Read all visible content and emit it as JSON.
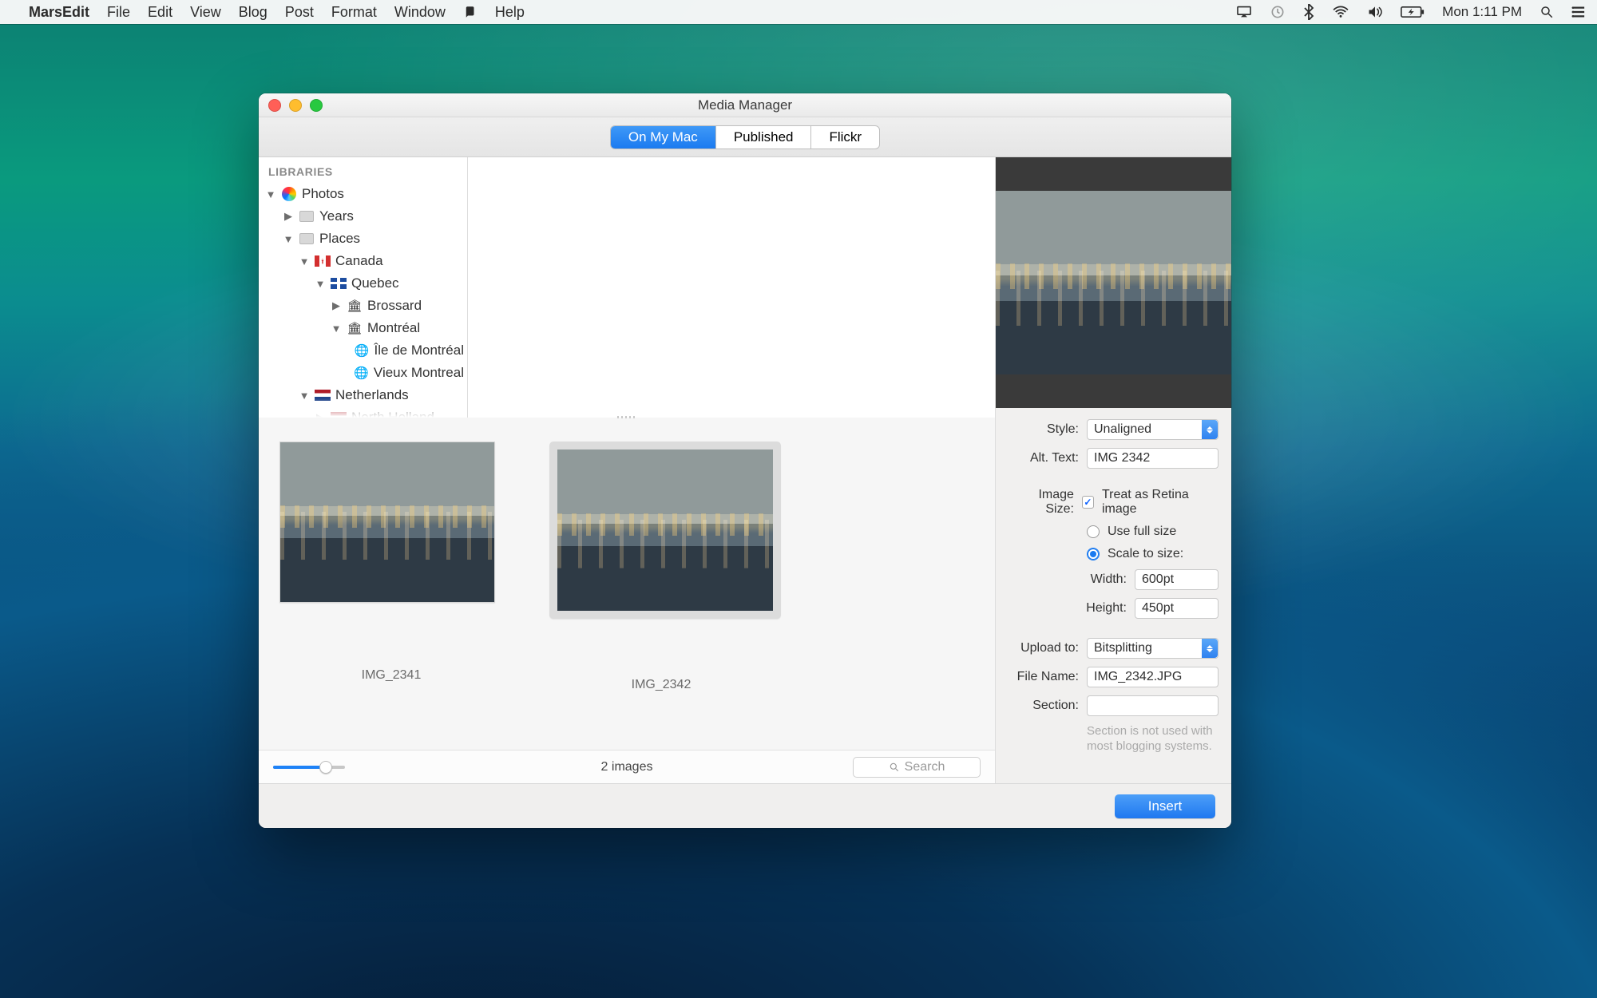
{
  "menubar": {
    "app_name": "MarsEdit",
    "items": [
      "File",
      "Edit",
      "View",
      "Blog",
      "Post",
      "Format",
      "Window",
      "",
      "Help"
    ],
    "clock": "Mon 1:11 PM"
  },
  "window": {
    "title": "Media Manager",
    "tabs": [
      "On My Mac",
      "Published",
      "Flickr"
    ],
    "active_tab": 0
  },
  "sidebar": {
    "header": "LIBRARIES",
    "tree": [
      {
        "d": 0,
        "arrow": "▼",
        "icon": "photos",
        "label": "Photos"
      },
      {
        "d": 1,
        "arrow": "▶",
        "icon": "folder",
        "label": "Years"
      },
      {
        "d": 1,
        "arrow": "▼",
        "icon": "folder",
        "label": "Places"
      },
      {
        "d": 2,
        "arrow": "▼",
        "icon": "flag-ca",
        "label": "Canada"
      },
      {
        "d": 3,
        "arrow": "▼",
        "icon": "flag-qc",
        "label": "Quebec"
      },
      {
        "d": 4,
        "arrow": "▶",
        "icon": "landmark",
        "label": "Brossard"
      },
      {
        "d": 4,
        "arrow": "▼",
        "icon": "landmark",
        "label": "Montréal"
      },
      {
        "d": 5,
        "arrow": "",
        "icon": "globe",
        "label": "Île de Montréal"
      },
      {
        "d": 5,
        "arrow": "",
        "icon": "globe",
        "label": "Vieux Montreal"
      },
      {
        "d": 2,
        "arrow": "▼",
        "icon": "flag-nl",
        "label": "Netherlands"
      },
      {
        "d": 3,
        "arrow": "▶",
        "icon": "flag-nl",
        "label": "North Holland"
      }
    ]
  },
  "grid": {
    "thumbs": [
      {
        "caption": "IMG_2341",
        "selected": false
      },
      {
        "caption": "IMG_2342",
        "selected": true
      }
    ],
    "count_text": "2 images",
    "search_placeholder": "Search"
  },
  "inspector": {
    "style_label": "Style:",
    "style_value": "Unaligned",
    "alt_label": "Alt. Text:",
    "alt_value": "IMG 2342",
    "size_label": "Image Size:",
    "retina_label": "Treat as Retina image",
    "retina_checked": true,
    "full_label": "Use full size",
    "full_on": false,
    "scale_label": "Scale to size:",
    "scale_on": true,
    "width_label": "Width:",
    "width_value": "600pt",
    "height_label": "Height:",
    "height_value": "450pt",
    "upload_label": "Upload to:",
    "upload_value": "Bitsplitting",
    "filename_label": "File Name:",
    "filename_value": "IMG_2342.JPG",
    "section_label": "Section:",
    "section_value": "",
    "hint1": "Section is not used with",
    "hint2": "most blogging systems.",
    "insert_label": "Insert"
  }
}
